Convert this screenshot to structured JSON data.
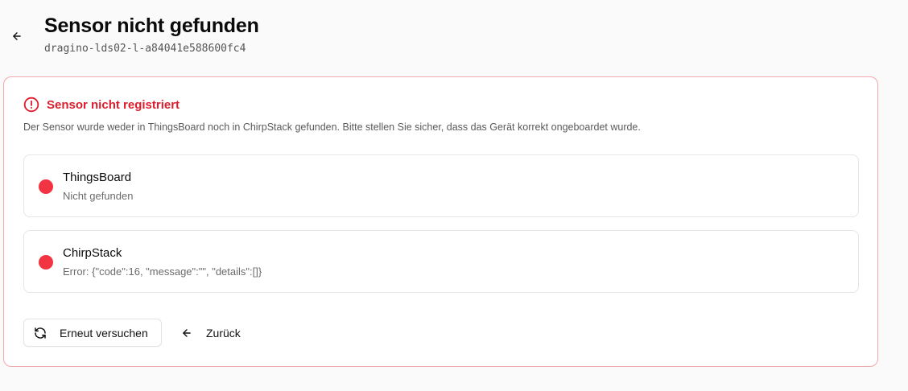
{
  "header": {
    "title": "Sensor nicht gefunden",
    "device_id": "dragino-lds02-l-a84041e588600fc4",
    "back_icon": "arrow-left-icon"
  },
  "alert": {
    "icon": "alert-circle-icon",
    "title": "Sensor nicht registriert",
    "description": "Der Sensor wurde weder in ThingsBoard noch in ChirpStack gefunden. Bitte stellen Sie sicher, dass das Gerät korrekt ongeboardet wurde.",
    "color": "#dc1d2c",
    "border_color": "#f2a9ad"
  },
  "statuses": [
    {
      "name": "ThingsBoard",
      "text": "Nicht gefunden",
      "status_color": "#f23341"
    },
    {
      "name": "ChirpStack",
      "text": "Error: {\"code\":16, \"message\":\"\", \"details\":[]}",
      "status_color": "#f23341"
    }
  ],
  "actions": {
    "retry_label": "Erneut versuchen",
    "retry_icon": "refresh-icon",
    "back_label": "Zurück",
    "back_icon": "arrow-left-icon"
  }
}
